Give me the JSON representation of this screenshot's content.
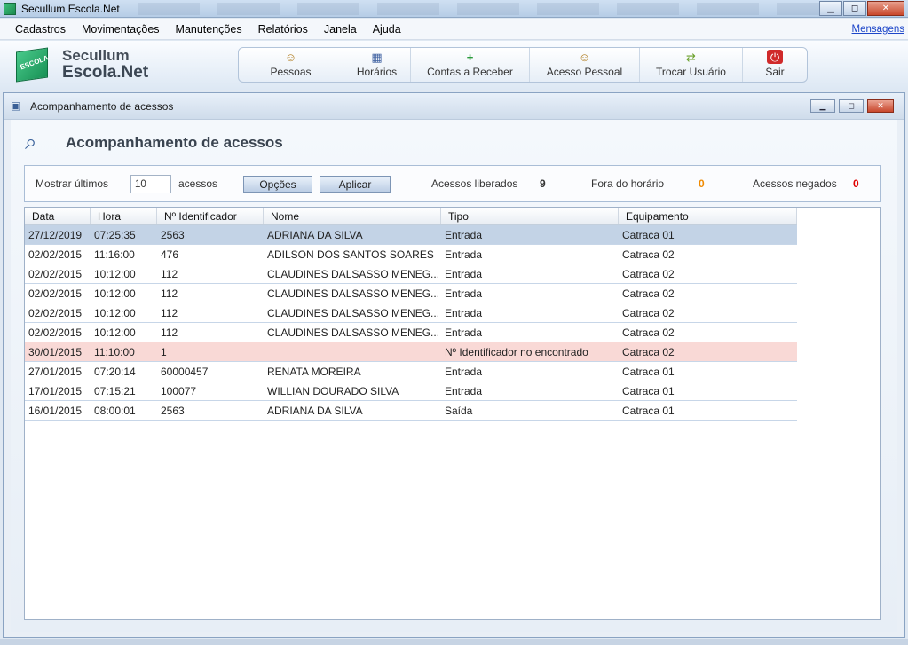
{
  "window": {
    "title": "Secullum Escola.Net",
    "min": "▁",
    "max": "◻",
    "close": "✕"
  },
  "menu": {
    "items": [
      "Cadastros",
      "Movimentações",
      "Manutenções",
      "Relatórios",
      "Janela",
      "Ajuda"
    ],
    "messages_link": "Mensagens"
  },
  "logo": {
    "line1": "Secullum",
    "line2": "Escola.Net",
    "cube_text": "ESCOLA"
  },
  "toolbar": [
    {
      "label": "Pessoas",
      "icon": "people-icon"
    },
    {
      "label": "Horários",
      "icon": "calendar-icon"
    },
    {
      "label": "Contas a Receber",
      "icon": "add-document-icon"
    },
    {
      "label": "Acesso Pessoal",
      "icon": "person-access-icon"
    },
    {
      "label": "Trocar Usuário",
      "icon": "switch-user-icon"
    },
    {
      "label": "Sair",
      "icon": "power-icon"
    }
  ],
  "inner_window": {
    "title": "Acompanhamento de acessos"
  },
  "page": {
    "heading": "Acompanhamento de acessos"
  },
  "filters": {
    "show_last_label": "Mostrar últimos",
    "show_last_value": "10",
    "accesses_label": "acessos",
    "options_button": "Opções",
    "apply_button": "Aplicar",
    "released_label": "Acessos liberados",
    "released_count": "9",
    "off_hours_label": "Fora do horário",
    "off_hours_count": "0",
    "denied_label": "Acessos negados",
    "denied_count": "0"
  },
  "colors": {
    "off_hours": "#f08a00",
    "denied": "#e00000",
    "selected_row": "#c3d3e6",
    "error_row": "#f9d9d6"
  },
  "grid": {
    "headers": [
      "Data",
      "Hora",
      "Nº Identificador",
      "Nome",
      "Tipo",
      "Equipamento"
    ],
    "rows": [
      [
        "27/12/2019",
        "07:25:35",
        "2563",
        "ADRIANA DA SILVA",
        "Entrada",
        "Catraca 01"
      ],
      [
        "02/02/2015",
        "11:16:00",
        "476",
        "ADILSON DOS SANTOS SOARES",
        "Entrada",
        "Catraca 02"
      ],
      [
        "02/02/2015",
        "10:12:00",
        "112",
        "CLAUDINES DALSASSO MENEG...",
        "Entrada",
        "Catraca 02"
      ],
      [
        "02/02/2015",
        "10:12:00",
        "112",
        "CLAUDINES DALSASSO MENEG...",
        "Entrada",
        "Catraca 02"
      ],
      [
        "02/02/2015",
        "10:12:00",
        "112",
        "CLAUDINES DALSASSO MENEG...",
        "Entrada",
        "Catraca 02"
      ],
      [
        "02/02/2015",
        "10:12:00",
        "112",
        "CLAUDINES DALSASSO MENEG...",
        "Entrada",
        "Catraca 02"
      ],
      [
        "30/01/2015",
        "11:10:00",
        "1",
        "",
        "Nº Identificador no encontrado",
        "Catraca 02"
      ],
      [
        "27/01/2015",
        "07:20:14",
        "60000457",
        "RENATA MOREIRA",
        "Entrada",
        "Catraca 01"
      ],
      [
        "17/01/2015",
        "07:15:21",
        "100077",
        "WILLIAN DOURADO SILVA",
        "Entrada",
        "Catraca 01"
      ],
      [
        "16/01/2015",
        "08:00:01",
        "2563",
        "ADRIANA DA SILVA",
        "Saída",
        "Catraca 01"
      ]
    ]
  }
}
